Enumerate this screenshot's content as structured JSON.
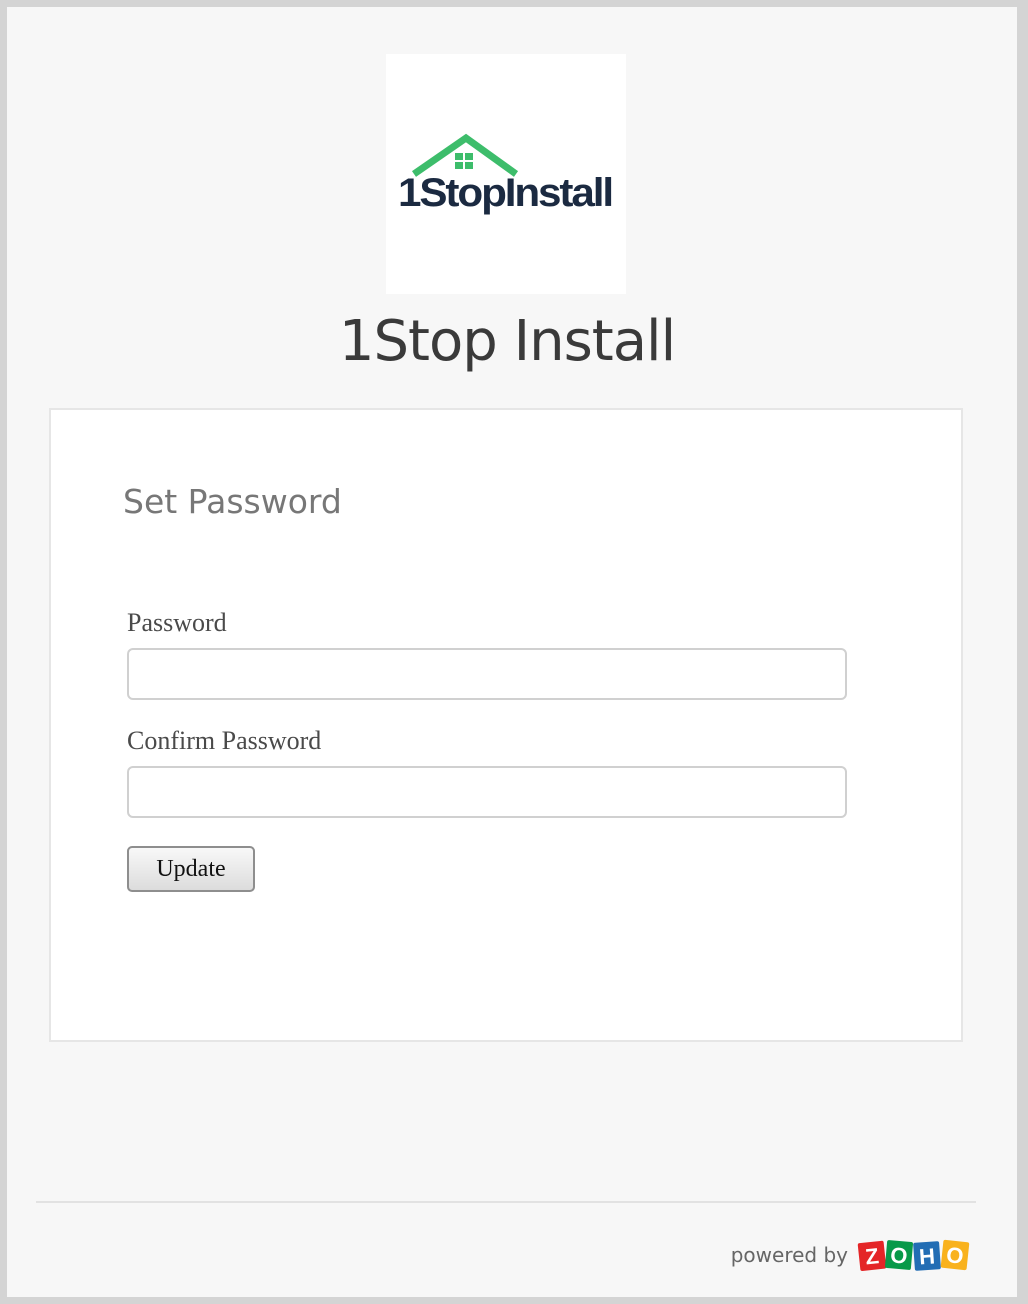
{
  "organization": {
    "name": "1Stop Install",
    "logo_text": "1StopInstall"
  },
  "form": {
    "title": "Set Password",
    "password_label": "Password",
    "password_value": "",
    "confirm_label": "Confirm Password",
    "confirm_value": "",
    "submit_label": "Update"
  },
  "footer": {
    "powered_by": "powered by",
    "brand_letters": [
      "Z",
      "O",
      "H",
      "O"
    ],
    "brand_colors": [
      "#e42527",
      "#089949",
      "#226db4",
      "#f9b21d"
    ]
  },
  "colors": {
    "logo_roof": "#3dbd6b",
    "logo_text": "#1b2a41"
  }
}
